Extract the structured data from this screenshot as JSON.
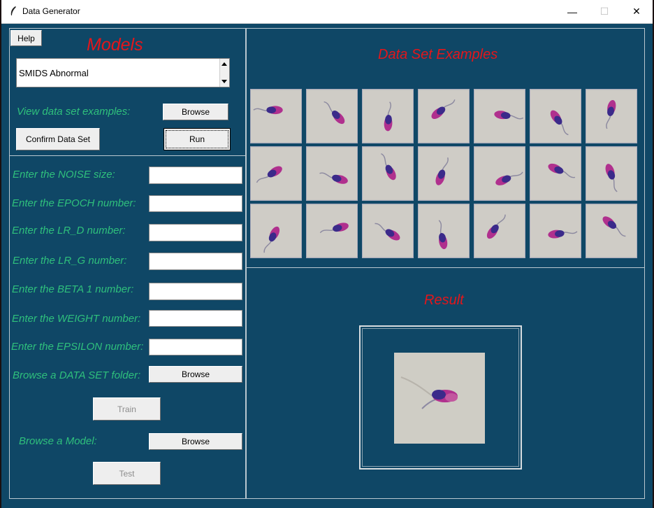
{
  "window": {
    "title": "Data Generator",
    "controls": {
      "minimize": "—",
      "maximize": "☐",
      "close": "✕"
    }
  },
  "models_panel": {
    "help_label": "Help",
    "heading": "Models",
    "model_list": {
      "selected": "SMIDS Abnormal"
    },
    "examples_label": "View data set examples:",
    "examples_browse": "Browse",
    "confirm_label": "Confirm Data Set",
    "run_label": "Run"
  },
  "params_panel": {
    "fields": [
      {
        "label": "Enter the NOISE size:",
        "value": ""
      },
      {
        "label": "Enter the EPOCH number:",
        "value": ""
      },
      {
        "label": "Enter the LR_D number:",
        "value": ""
      },
      {
        "label": "Enter the LR_G number:",
        "value": ""
      },
      {
        "label": "Enter the BETA 1 number:",
        "value": ""
      },
      {
        "label": "Enter the WEIGHT number:",
        "value": ""
      },
      {
        "label": "Enter the EPSILON number:",
        "value": ""
      }
    ],
    "dataset_label": "Browse a DATA SET folder:",
    "dataset_browse": "Browse",
    "train_label": "Train",
    "model_label": "Browse a Model:",
    "model_browse": "Browse",
    "test_label": "Test"
  },
  "examples_panel": {
    "heading": "Data Set Examples",
    "image_count": 21,
    "image_subject": "sperm-cell-image"
  },
  "result_panel": {
    "heading": "Result"
  },
  "colors": {
    "background": "#0f4766",
    "heading": "#e3161b",
    "label": "#2fc07c",
    "cell_bg": "#cfccc6",
    "stain_dark": "#3b2a8a",
    "stain_light": "#b0308e"
  }
}
